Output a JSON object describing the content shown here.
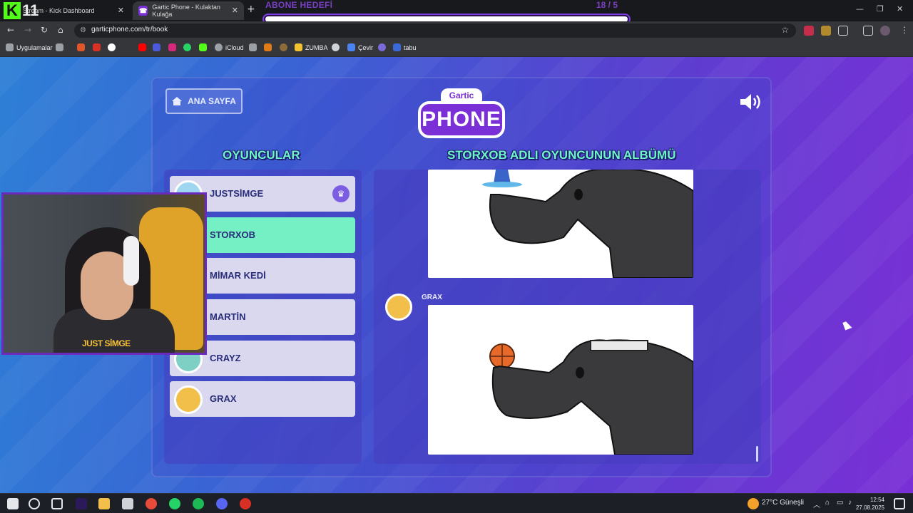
{
  "browser": {
    "tabs": [
      {
        "label": "Stream - Kick Dashboard",
        "active": false
      },
      {
        "label": "Gartic Phone - Kulaktan Kulağa",
        "active": true
      }
    ],
    "url": "garticphone.com/tr/book",
    "bookmarks": [
      "Uygulamalar",
      "iCloud",
      "ZUMBA",
      "Çevir",
      "tabu"
    ]
  },
  "overlay": {
    "kick_number": "11",
    "goal_title": "ABONE HEDEFİ",
    "goal_count": "18  / 5",
    "goal_progress": 1.0
  },
  "game": {
    "home_label": "ANA SAYFA",
    "logo_top": "Gartic",
    "logo_main": "PHONE",
    "players_title": "OYUNCULAR",
    "album_title": "STORXOB ADLI OYUNCUNUN ALBÜMÜ",
    "players": [
      {
        "name": "JUSTSİMGE",
        "host": true,
        "active": false
      },
      {
        "name": "STORXOB",
        "host": false,
        "active": true
      },
      {
        "name": "MİMAR KEDİ",
        "host": false,
        "active": false
      },
      {
        "name": "MARTİN",
        "host": false,
        "active": false
      },
      {
        "name": "CRAYZ",
        "host": false,
        "active": false
      },
      {
        "name": "GRAX",
        "host": false,
        "active": false
      }
    ],
    "album_author": "GRAX"
  },
  "webcam": {
    "label": "JUST SİMGE"
  },
  "taskbar": {
    "weather": "27°C  Güneşli",
    "time": "12:54",
    "date": "27.08.2025"
  },
  "colors": {
    "accent": "#75f0c4",
    "title": "#6ff5c8",
    "kick": "#53fc18"
  }
}
